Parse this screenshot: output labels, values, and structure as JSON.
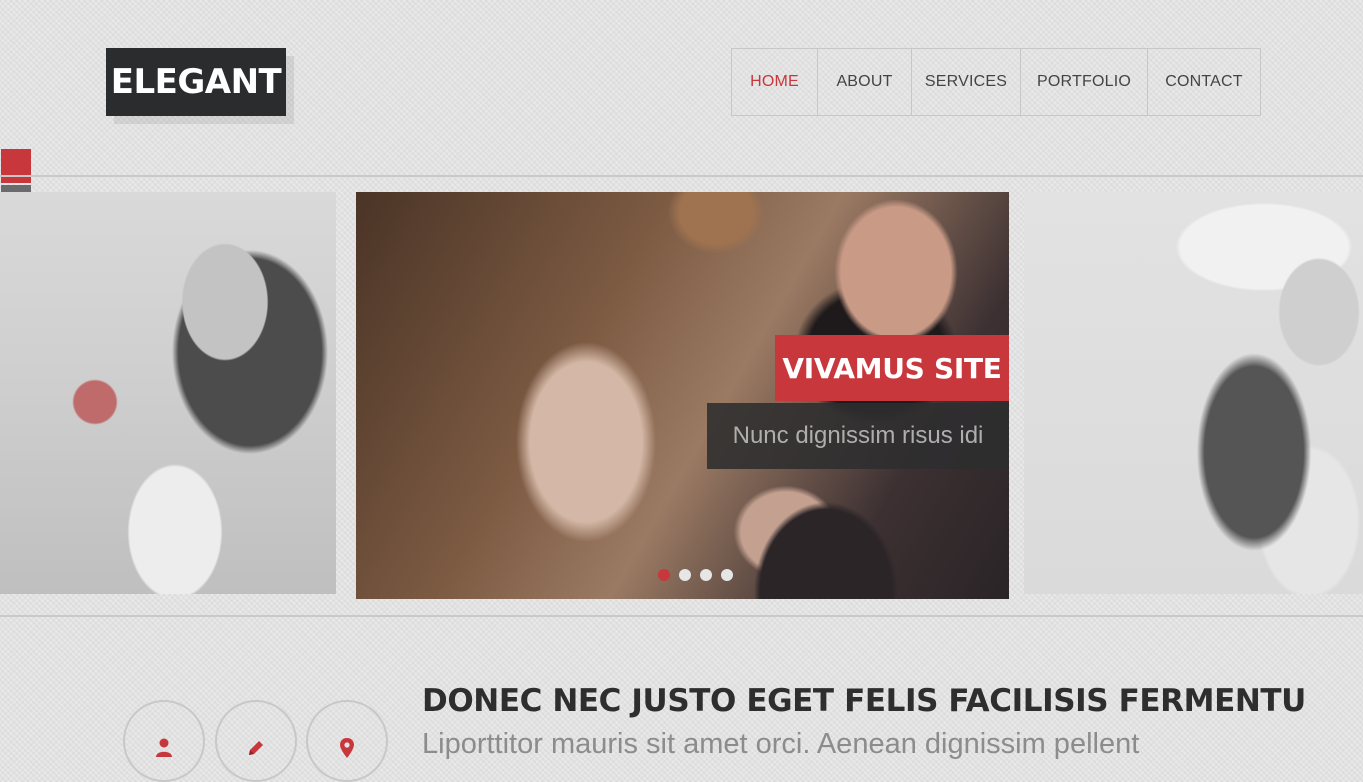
{
  "header": {
    "logo": "ELEGANT",
    "nav": [
      {
        "label": "HOME",
        "active": true
      },
      {
        "label": "ABOUT",
        "active": false
      },
      {
        "label": "SERVICES",
        "active": false
      },
      {
        "label": "PORTFOLIO",
        "active": false
      },
      {
        "label": "CONTACT",
        "active": false
      }
    ]
  },
  "slider": {
    "caption_title": "VIVAMUS SITE",
    "caption_text": "Nunc dignissim risus idi",
    "slide_count": 4,
    "active_index": 0
  },
  "features": {
    "icons": [
      "user-icon",
      "pencil-icon",
      "map-pin-icon"
    ],
    "heading": "DONEC NEC JUSTO EGET FELIS FACILISIS FERMENTU",
    "text": "Liporttitor mauris sit amet orci. Aenean dignissim pellent"
  },
  "colors": {
    "accent": "#c8373c",
    "dark": "#2b2c2e",
    "background": "#e4e4e4"
  }
}
